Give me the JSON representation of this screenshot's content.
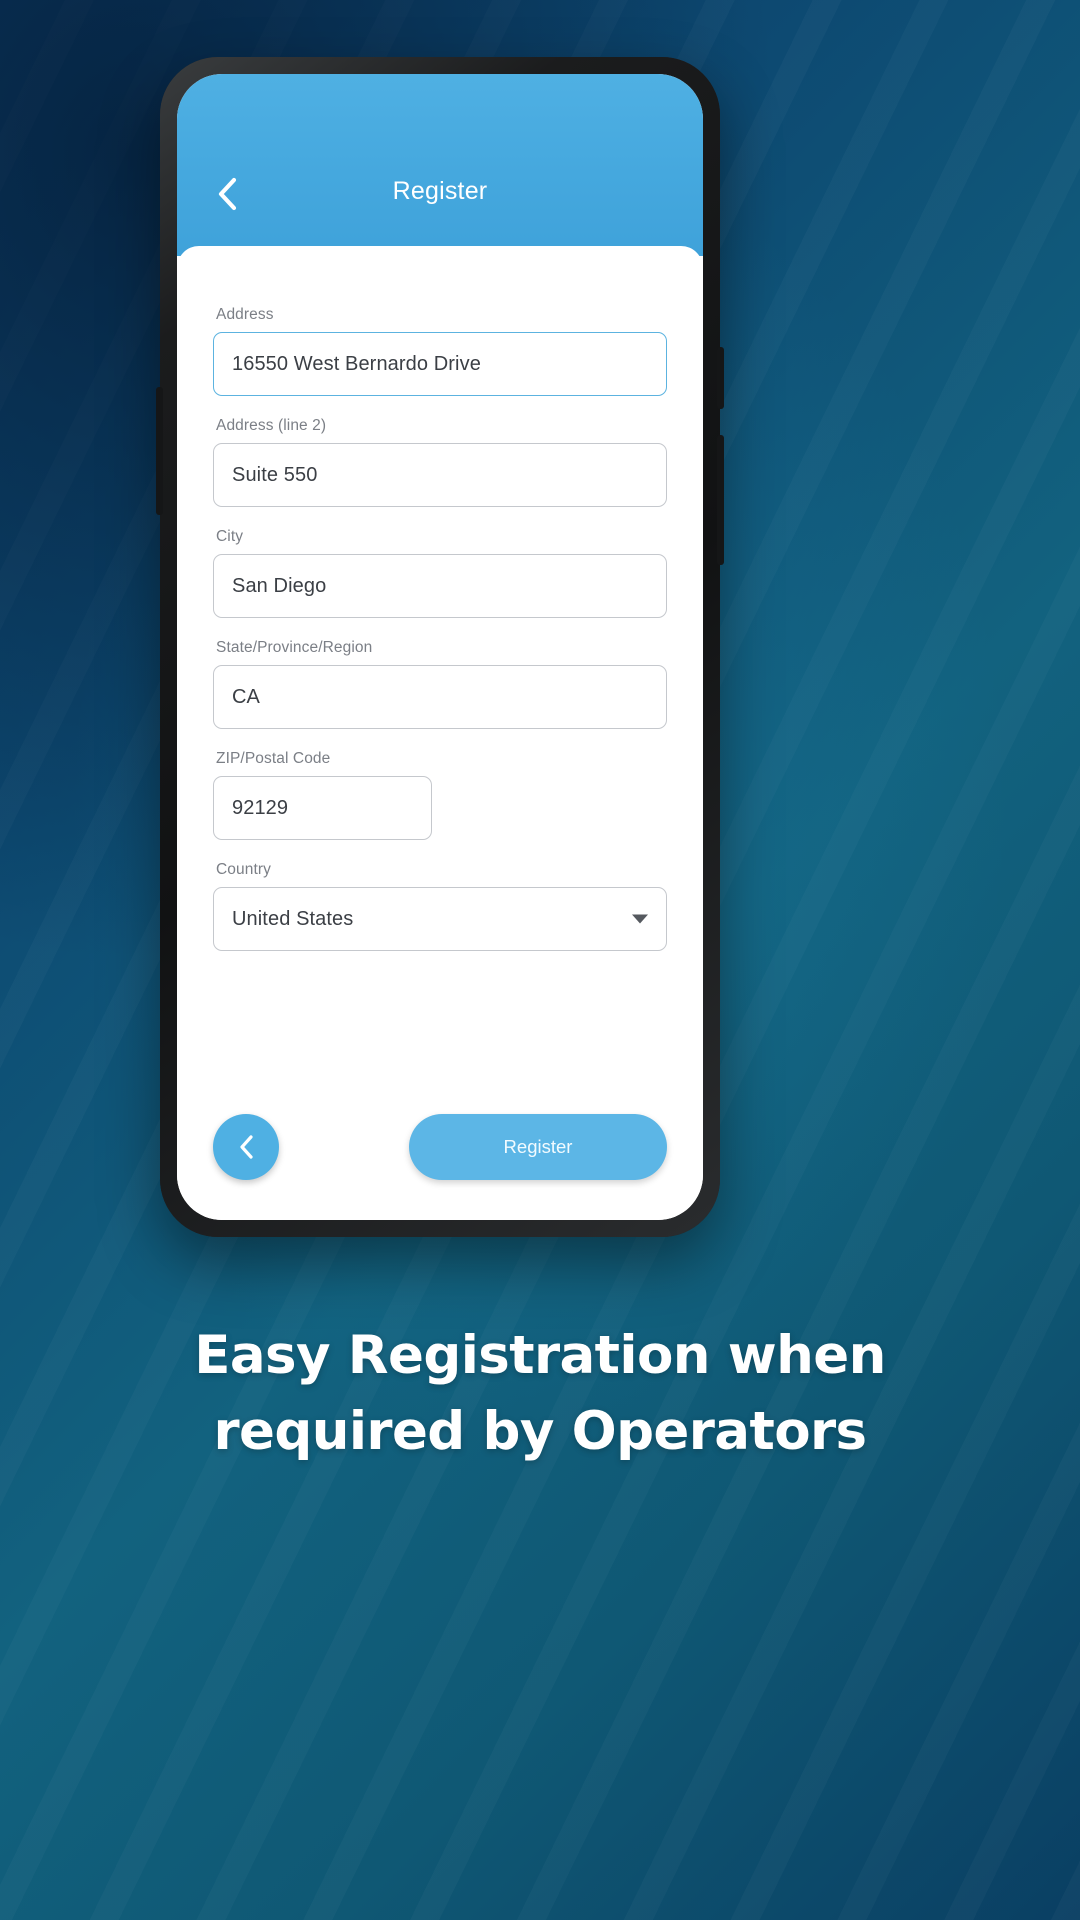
{
  "background": {
    "base_color": "#0b3b66",
    "accent_color": "#12627f"
  },
  "phone": {
    "app": {
      "header": {
        "title": "Register",
        "back_icon": "chevron-left-icon",
        "bg_color": "#45a8de"
      },
      "form": {
        "fields": [
          {
            "label": "Address",
            "value": "16550 West Bernardo Drive",
            "type": "text",
            "focused": true,
            "narrow": false
          },
          {
            "label": "Address (line 2)",
            "value": "Suite 550",
            "type": "text",
            "focused": false,
            "narrow": false
          },
          {
            "label": "City",
            "value": "San Diego",
            "type": "text",
            "focused": false,
            "narrow": false
          },
          {
            "label": "State/Province/Region",
            "value": "CA",
            "type": "text",
            "focused": false,
            "narrow": false
          },
          {
            "label": "ZIP/Postal Code",
            "value": "92129",
            "type": "text",
            "focused": false,
            "narrow": true
          },
          {
            "label": "Country",
            "value": "United States",
            "type": "select",
            "focused": false,
            "narrow": false
          }
        ]
      },
      "actions": {
        "back_fab_icon": "chevron-left-icon",
        "submit_label": "Register",
        "submit_color": "#5cb6e6",
        "fab_color": "#4fb0e3"
      }
    }
  },
  "caption": {
    "line1": "Easy Registration when",
    "line2": "required by Operators"
  }
}
